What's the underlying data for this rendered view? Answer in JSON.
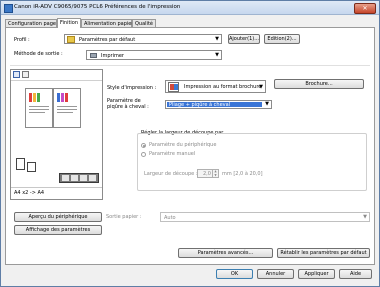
{
  "window": {
    "title": "Canon iR-ADV C9065/9075 PCL6 Préférences de l'impression",
    "close_glyph": "✕"
  },
  "tabs": [
    {
      "label": "Configuration page"
    },
    {
      "label": "Finition"
    },
    {
      "label": "Alimentation papier"
    },
    {
      "label": "Qualité"
    }
  ],
  "profile": {
    "label": "Profil :",
    "value": "Paramètres par défaut",
    "add_label": "Ajouter(1)...",
    "edit_label": "Edition(2)..."
  },
  "output": {
    "label": "Méthode de sortie :",
    "value": "Imprimer"
  },
  "print_style": {
    "label": "Style d'impression :",
    "value": "Impression au format brochure"
  },
  "booklet_button": {
    "label": "Brochure..."
  },
  "saddle": {
    "label": "Paramètre de\npiqûre à cheval :",
    "value": "Pliage + piqûre à cheval"
  },
  "trim": {
    "group_label": "Régler la largeur de découpe par",
    "option_device": "Paramètre du périphérique",
    "option_manual": "Paramètre manuel",
    "width_label": "Largeur de découpe :",
    "width_value": "2,0",
    "width_unit": "mm [2,0 à 20,0]"
  },
  "preview": {
    "caption": "A4 x2 -> A4"
  },
  "device_preview_button": {
    "label": "Aperçu du périphérique"
  },
  "show_settings_button": {
    "label": "Affichage des paramètres"
  },
  "paper_output": {
    "label": "Sortie papier :",
    "value": "Auto"
  },
  "advanced_button": {
    "label": "Paramètres avancés..."
  },
  "restore_button": {
    "label": "Rétablir les paramètres par défaut"
  },
  "footer": {
    "ok": "OK",
    "cancel": "Annuler",
    "apply": "Appliquer",
    "help": "Aide"
  }
}
